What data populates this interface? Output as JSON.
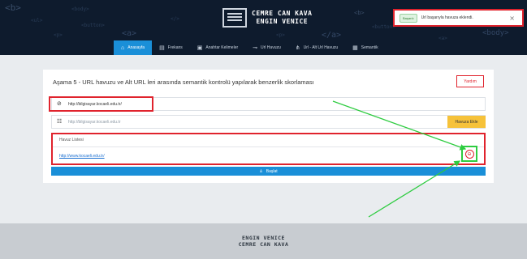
{
  "header": {
    "brand_line1": "CEMRE CAN KAVA",
    "brand_line2": "ENGIN VENICE",
    "decorations": [
      "<b>",
      "<body>",
      "<a>",
      "<button>",
      "<ul>",
      "</>",
      "<p>",
      "<b>",
      "</a>",
      "<a>",
      "<body>",
      "<button>",
      "<p>"
    ]
  },
  "nav": [
    {
      "icon": "home-icon",
      "glyph": "⌂",
      "label": "Anasayfa",
      "active": true
    },
    {
      "icon": "file-icon",
      "glyph": "▤",
      "label": "Frekans",
      "active": false
    },
    {
      "icon": "keywords-icon",
      "glyph": "▣",
      "label": "Anahtar Kelimeler",
      "active": false
    },
    {
      "icon": "link-icon",
      "glyph": "⊸",
      "label": "Url Havuzu",
      "active": false
    },
    {
      "icon": "sitemap-icon",
      "glyph": "⋔",
      "label": "Url - Alt Url Havuzu",
      "active": false
    },
    {
      "icon": "semantic-icon",
      "glyph": "▦",
      "label": "Semantik",
      "active": false
    }
  ],
  "toast": {
    "badge": "Başarılı",
    "message": "Url başarıyla havuza eklendi.",
    "close": "×"
  },
  "main": {
    "title": "Aşama 5 - URL havuzu ve Alt URL leri arasında semantik kontrolü yapılarak benzerlik skorlaması",
    "help_label": "Yardım",
    "url_value": "http://bilgisayar.kocaeli.edu.tr/",
    "pool_placeholder": "http://bilgisayar.kocaeli.edu.tr",
    "add_label": "Havuza Ekle",
    "list_header": "Havuz Listesi",
    "list_items": [
      "http://www.kocaeli.edu.tr/"
    ],
    "start_label": "Başlat"
  },
  "footer": {
    "line1": "ENGIN VENICE",
    "line2": "CEMRE CAN KAVA"
  },
  "colors": {
    "header_bg": "#0e1b2d",
    "accent": "#1a8fd8",
    "warning": "#f6c23a",
    "highlight_red": "#e0232d",
    "highlight_green": "#2ecc40"
  }
}
